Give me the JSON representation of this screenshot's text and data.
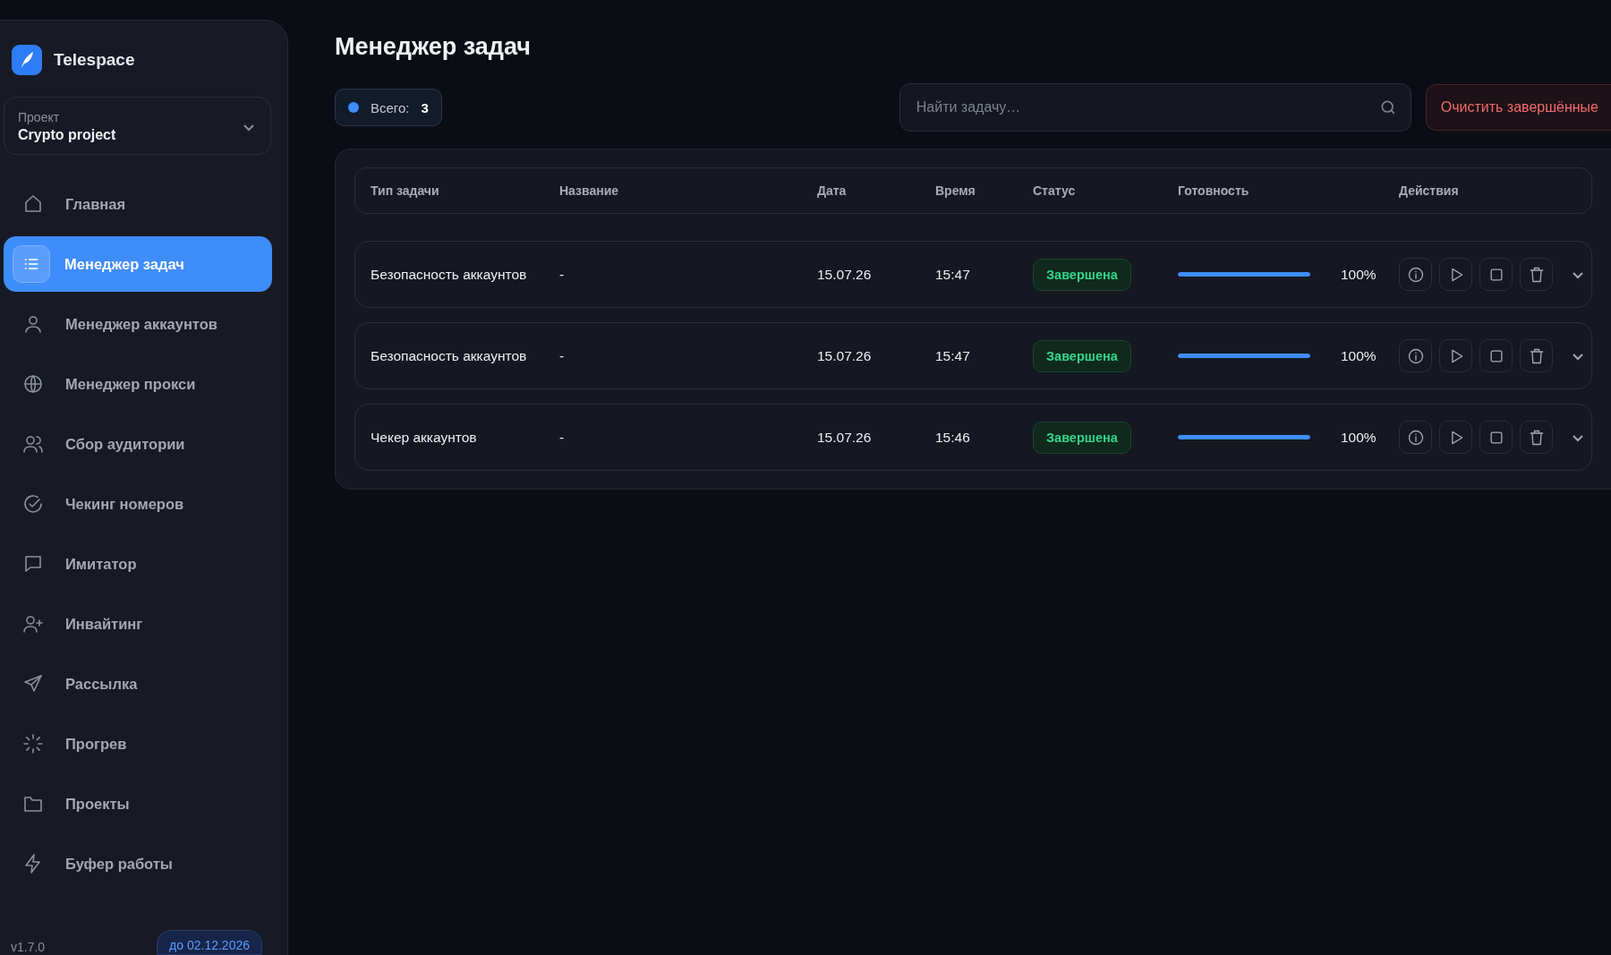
{
  "app": {
    "name": "Telespace",
    "version": "v1.7.0",
    "license": "до 02.12.2026"
  },
  "project": {
    "label": "Проект",
    "value": "Crypto project"
  },
  "sidebar": {
    "items": [
      {
        "label": "Главная",
        "selected": false
      },
      {
        "label": "Менеджер задач",
        "selected": true
      },
      {
        "label": "Менеджер аккаунтов",
        "selected": false
      },
      {
        "label": "Менеджер прокси",
        "selected": false
      },
      {
        "label": "Сбор аудитории",
        "selected": false
      },
      {
        "label": "Чекинг номеров",
        "selected": false
      },
      {
        "label": "Имитатор",
        "selected": false
      },
      {
        "label": "Инвайтинг",
        "selected": false
      },
      {
        "label": "Рассылка",
        "selected": false
      },
      {
        "label": "Прогрев",
        "selected": false
      },
      {
        "label": "Проекты",
        "selected": false
      },
      {
        "label": "Буфер работы",
        "selected": false
      }
    ]
  },
  "page": {
    "title": "Менеджер задач",
    "total_label": "Всего:",
    "total": "3",
    "search": {
      "placeholder": "Найти задачу…"
    },
    "clear_button": "Очистить завершённые"
  },
  "table": {
    "columns": [
      "Тип задачи",
      "Название",
      "Дата",
      "Время",
      "Статус",
      "Готовность",
      "Действия"
    ],
    "rows": [
      {
        "type": "Безопасность аккаунтов",
        "name": "-",
        "date": "15.07.26",
        "time": "15:47",
        "status": "Завершена",
        "level": 1,
        "reading": "100%"
      },
      {
        "type": "Безопасность аккаунтов",
        "name": "-",
        "date": "15.07.26",
        "time": "15:47",
        "status": "Завершена",
        "level": 1,
        "reading": "100%"
      },
      {
        "type": "Чекер аккаунтов",
        "name": "-",
        "date": "15.07.26",
        "time": "15:46",
        "status": "Завершена",
        "level": 1,
        "reading": "100%"
      }
    ]
  }
}
